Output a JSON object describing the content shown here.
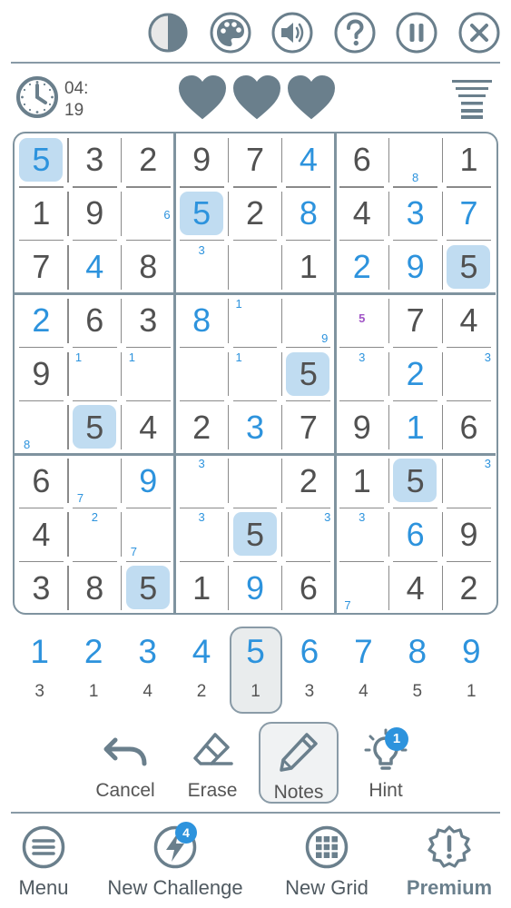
{
  "colors": {
    "icon": "#6a7f8c",
    "border": "#7f939f",
    "user_digit": "#2d93dd",
    "given_digit": "#515151",
    "highlight": "#c0dcf1",
    "note_special": "#a054c6",
    "badge": "#2d93dd"
  },
  "top_bar": {
    "icons": [
      "contrast-icon",
      "palette-icon",
      "sound-icon",
      "help-icon",
      "pause-icon",
      "close-icon"
    ]
  },
  "status": {
    "timer_minutes": "04:",
    "timer_seconds": "19",
    "lives_remaining": 3,
    "lives_total": 3
  },
  "board": {
    "highlighted_digit": 5,
    "cells": [
      [
        {
          "v": "5",
          "u": true
        },
        {
          "v": "3"
        },
        {
          "v": "2"
        },
        {
          "v": "9"
        },
        {
          "v": "7"
        },
        {
          "v": "4",
          "u": true
        },
        {
          "v": "6"
        },
        {
          "v": "",
          "n": [
            [
              "8",
              "b"
            ]
          ]
        },
        {
          "v": "1"
        }
      ],
      [
        {
          "v": "1"
        },
        {
          "v": "9"
        },
        {
          "v": "",
          "n": [
            [
              "6",
              "r"
            ]
          ]
        },
        {
          "v": "5",
          "u": true
        },
        {
          "v": "2"
        },
        {
          "v": "8",
          "u": true
        },
        {
          "v": "4"
        },
        {
          "v": "3",
          "u": true
        },
        {
          "v": "7",
          "u": true
        }
      ],
      [
        {
          "v": "7"
        },
        {
          "v": "4",
          "u": true
        },
        {
          "v": "8"
        },
        {
          "v": "",
          "n": [
            [
              "3",
              "t"
            ]
          ]
        },
        {
          "v": ""
        },
        {
          "v": "1"
        },
        {
          "v": "2",
          "u": true
        },
        {
          "v": "9",
          "u": true
        },
        {
          "v": "5"
        }
      ],
      [
        {
          "v": "2",
          "u": true
        },
        {
          "v": "6"
        },
        {
          "v": "3"
        },
        {
          "v": "8",
          "u": true
        },
        {
          "v": "",
          "n": [
            [
              "1",
              "tl"
            ]
          ]
        },
        {
          "v": "",
          "n": [
            [
              "9",
              "br"
            ]
          ]
        },
        {
          "v": "",
          "n": [
            [
              "5",
              "c",
              "p"
            ]
          ]
        },
        {
          "v": "7"
        },
        {
          "v": "4"
        }
      ],
      [
        {
          "v": "9"
        },
        {
          "v": "",
          "n": [
            [
              "1",
              "tl"
            ]
          ]
        },
        {
          "v": "",
          "n": [
            [
              "1",
              "tl"
            ]
          ]
        },
        {
          "v": ""
        },
        {
          "v": "",
          "n": [
            [
              "1",
              "tl"
            ]
          ]
        },
        {
          "v": "5"
        },
        {
          "v": "",
          "n": [
            [
              "3",
              "t"
            ]
          ]
        },
        {
          "v": "2",
          "u": true
        },
        {
          "v": "",
          "n": [
            [
              "3",
              "tr"
            ]
          ]
        }
      ],
      [
        {
          "v": "",
          "n": [
            [
              "8",
              "bl"
            ]
          ]
        },
        {
          "v": "5"
        },
        {
          "v": "4"
        },
        {
          "v": "2"
        },
        {
          "v": "3",
          "u": true
        },
        {
          "v": "7"
        },
        {
          "v": "9"
        },
        {
          "v": "1",
          "u": true
        },
        {
          "v": "6"
        }
      ],
      [
        {
          "v": "6"
        },
        {
          "v": "",
          "n": [
            [
              "7",
              "bl"
            ]
          ]
        },
        {
          "v": "9",
          "u": true
        },
        {
          "v": "",
          "n": [
            [
              "3",
              "t"
            ]
          ]
        },
        {
          "v": ""
        },
        {
          "v": "2"
        },
        {
          "v": "1"
        },
        {
          "v": "5"
        },
        {
          "v": "",
          "n": [
            [
              "3",
              "tr"
            ]
          ]
        }
      ],
      [
        {
          "v": "4"
        },
        {
          "v": "",
          "n": [
            [
              "2",
              "t"
            ]
          ]
        },
        {
          "v": "",
          "n": [
            [
              "7",
              "bl"
            ]
          ]
        },
        {
          "v": "",
          "n": [
            [
              "3",
              "t"
            ]
          ]
        },
        {
          "v": "5"
        },
        {
          "v": "",
          "n": [
            [
              "3",
              "tr"
            ]
          ]
        },
        {
          "v": "",
          "n": [
            [
              "3",
              "t"
            ]
          ]
        },
        {
          "v": "6",
          "u": true
        },
        {
          "v": "9"
        }
      ],
      [
        {
          "v": "3"
        },
        {
          "v": "8"
        },
        {
          "v": "5"
        },
        {
          "v": "1"
        },
        {
          "v": "9",
          "u": true
        },
        {
          "v": "6"
        },
        {
          "v": "",
          "n": [
            [
              "7",
              "bl"
            ]
          ]
        },
        {
          "v": "4"
        },
        {
          "v": "2"
        }
      ]
    ]
  },
  "numpad": {
    "selected": "5",
    "keys": [
      {
        "digit": "1",
        "count": "3"
      },
      {
        "digit": "2",
        "count": "1"
      },
      {
        "digit": "3",
        "count": "4"
      },
      {
        "digit": "4",
        "count": "2"
      },
      {
        "digit": "5",
        "count": "1"
      },
      {
        "digit": "6",
        "count": "3"
      },
      {
        "digit": "7",
        "count": "4"
      },
      {
        "digit": "8",
        "count": "5"
      },
      {
        "digit": "9",
        "count": "1"
      }
    ]
  },
  "tools": {
    "cancel_label": "Cancel",
    "erase_label": "Erase",
    "notes_label": "Notes",
    "notes_active": true,
    "hint_label": "Hint",
    "hint_badge": "1"
  },
  "bottom_nav": {
    "menu_label": "Menu",
    "challenge_label": "New Challenge",
    "challenge_badge": "4",
    "newgrid_label": "New Grid",
    "premium_label": "Premium"
  }
}
